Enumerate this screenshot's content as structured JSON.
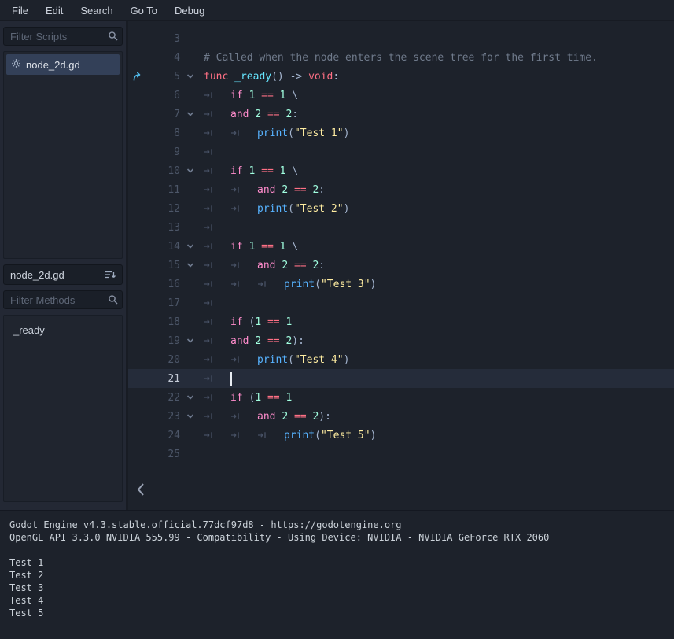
{
  "menu": {
    "items": [
      "File",
      "Edit",
      "Search",
      "Go To",
      "Debug"
    ]
  },
  "sidebar": {
    "filter_scripts_placeholder": "Filter Scripts",
    "scripts": [
      {
        "label": "node_2d.gd",
        "icon": "gear-icon",
        "selected": true
      }
    ],
    "current_script_label": "node_2d.gd",
    "filter_methods_placeholder": "Filter Methods",
    "methods": [
      {
        "label": "_ready"
      }
    ]
  },
  "editor": {
    "lines": [
      {
        "n": 3
      },
      {
        "n": 4,
        "tok": [
          [
            "c",
            "# Called when the node enters the scene tree for the first time."
          ]
        ]
      },
      {
        "n": 5,
        "fold": 1,
        "ovr": 1,
        "tok": [
          [
            "kw",
            "func"
          ],
          [
            "t",
            " "
          ],
          [
            "fd",
            "_ready"
          ],
          [
            "p",
            "()"
          ],
          [
            "t",
            " "
          ],
          [
            "p",
            "->"
          ],
          [
            "t",
            " "
          ],
          [
            "kw",
            "void"
          ],
          [
            "p",
            ":"
          ]
        ]
      },
      {
        "n": 6,
        "tabs": 1,
        "tok": [
          [
            "cf",
            "if"
          ],
          [
            "t",
            " "
          ],
          [
            "num",
            "1"
          ],
          [
            "t",
            " "
          ],
          [
            "op",
            "=="
          ],
          [
            "t",
            " "
          ],
          [
            "num",
            "1"
          ],
          [
            "t",
            " "
          ],
          [
            "p",
            "\\"
          ]
        ]
      },
      {
        "n": 7,
        "tabs": 1,
        "fold": 1,
        "tok": [
          [
            "cf",
            "and"
          ],
          [
            "t",
            " "
          ],
          [
            "num",
            "2"
          ],
          [
            "t",
            " "
          ],
          [
            "op",
            "=="
          ],
          [
            "t",
            " "
          ],
          [
            "num",
            "2"
          ],
          [
            "p",
            ":"
          ]
        ]
      },
      {
        "n": 8,
        "tabs": 2,
        "tok": [
          [
            "fn",
            "print"
          ],
          [
            "p",
            "("
          ],
          [
            "s",
            "\"Test 1\""
          ],
          [
            "p",
            ")"
          ]
        ]
      },
      {
        "n": 9,
        "tabs": 1
      },
      {
        "n": 10,
        "tabs": 1,
        "fold": 1,
        "tok": [
          [
            "cf",
            "if"
          ],
          [
            "t",
            " "
          ],
          [
            "num",
            "1"
          ],
          [
            "t",
            " "
          ],
          [
            "op",
            "=="
          ],
          [
            "t",
            " "
          ],
          [
            "num",
            "1"
          ],
          [
            "t",
            " "
          ],
          [
            "p",
            "\\"
          ]
        ]
      },
      {
        "n": 11,
        "tabs": 2,
        "tok": [
          [
            "cf",
            "and"
          ],
          [
            "t",
            " "
          ],
          [
            "num",
            "2"
          ],
          [
            "t",
            " "
          ],
          [
            "op",
            "=="
          ],
          [
            "t",
            " "
          ],
          [
            "num",
            "2"
          ],
          [
            "p",
            ":"
          ]
        ]
      },
      {
        "n": 12,
        "tabs": 2,
        "tok": [
          [
            "fn",
            "print"
          ],
          [
            "p",
            "("
          ],
          [
            "s",
            "\"Test 2\""
          ],
          [
            "p",
            ")"
          ]
        ]
      },
      {
        "n": 13,
        "tabs": 1
      },
      {
        "n": 14,
        "tabs": 1,
        "fold": 1,
        "tok": [
          [
            "cf",
            "if"
          ],
          [
            "t",
            " "
          ],
          [
            "num",
            "1"
          ],
          [
            "t",
            " "
          ],
          [
            "op",
            "=="
          ],
          [
            "t",
            " "
          ],
          [
            "num",
            "1"
          ],
          [
            "t",
            " "
          ],
          [
            "p",
            "\\"
          ]
        ]
      },
      {
        "n": 15,
        "tabs": 2,
        "fold": 1,
        "tok": [
          [
            "cf",
            "and"
          ],
          [
            "t",
            " "
          ],
          [
            "num",
            "2"
          ],
          [
            "t",
            " "
          ],
          [
            "op",
            "=="
          ],
          [
            "t",
            " "
          ],
          [
            "num",
            "2"
          ],
          [
            "p",
            ":"
          ]
        ]
      },
      {
        "n": 16,
        "tabs": 3,
        "tok": [
          [
            "fn",
            "print"
          ],
          [
            "p",
            "("
          ],
          [
            "s",
            "\"Test 3\""
          ],
          [
            "p",
            ")"
          ]
        ]
      },
      {
        "n": 17,
        "tabs": 1
      },
      {
        "n": 18,
        "tabs": 1,
        "tok": [
          [
            "cf",
            "if"
          ],
          [
            "t",
            " "
          ],
          [
            "p",
            "("
          ],
          [
            "num",
            "1"
          ],
          [
            "t",
            " "
          ],
          [
            "op",
            "=="
          ],
          [
            "t",
            " "
          ],
          [
            "num",
            "1"
          ]
        ]
      },
      {
        "n": 19,
        "tabs": 1,
        "fold": 1,
        "tok": [
          [
            "cf",
            "and"
          ],
          [
            "t",
            " "
          ],
          [
            "num",
            "2"
          ],
          [
            "t",
            " "
          ],
          [
            "op",
            "=="
          ],
          [
            "t",
            " "
          ],
          [
            "num",
            "2"
          ],
          [
            "p",
            "):"
          ]
        ]
      },
      {
        "n": 20,
        "tabs": 2,
        "tok": [
          [
            "fn",
            "print"
          ],
          [
            "p",
            "("
          ],
          [
            "s",
            "\"Test 4\""
          ],
          [
            "p",
            ")"
          ]
        ]
      },
      {
        "n": 21,
        "tabs": 1,
        "cursor": 1
      },
      {
        "n": 22,
        "tabs": 1,
        "fold": 1,
        "tok": [
          [
            "cf",
            "if"
          ],
          [
            "t",
            " "
          ],
          [
            "p",
            "("
          ],
          [
            "num",
            "1"
          ],
          [
            "t",
            " "
          ],
          [
            "op",
            "=="
          ],
          [
            "t",
            " "
          ],
          [
            "num",
            "1"
          ]
        ]
      },
      {
        "n": 23,
        "tabs": 2,
        "fold": 1,
        "tok": [
          [
            "cf",
            "and"
          ],
          [
            "t",
            " "
          ],
          [
            "num",
            "2"
          ],
          [
            "t",
            " "
          ],
          [
            "op",
            "=="
          ],
          [
            "t",
            " "
          ],
          [
            "num",
            "2"
          ],
          [
            "p",
            "):"
          ]
        ]
      },
      {
        "n": 24,
        "tabs": 3,
        "tok": [
          [
            "fn",
            "print"
          ],
          [
            "p",
            "("
          ],
          [
            "s",
            "\"Test 5\""
          ],
          [
            "p",
            ")"
          ]
        ]
      },
      {
        "n": 25
      }
    ]
  },
  "output": {
    "lines": [
      "Godot Engine v4.3.stable.official.77dcf97d8 - https://godotengine.org",
      "OpenGL API 3.3.0 NVIDIA 555.99 - Compatibility - Using Device: NVIDIA - NVIDIA GeForce RTX 2060",
      "",
      "Test 1",
      "Test 2",
      "Test 3",
      "Test 4",
      "Test 5"
    ]
  },
  "colors": {
    "accent_selection": "#334058",
    "keyword": "#ff7085",
    "control_flow": "#ff8ccc",
    "number": "#a1ffe0",
    "string": "#ffeda1",
    "function_call": "#57b3ff",
    "function_definition": "#66e6ff",
    "comment": "#707b8c",
    "editor_bg": "#1d222b",
    "override_icon": "#4fb8e8"
  }
}
